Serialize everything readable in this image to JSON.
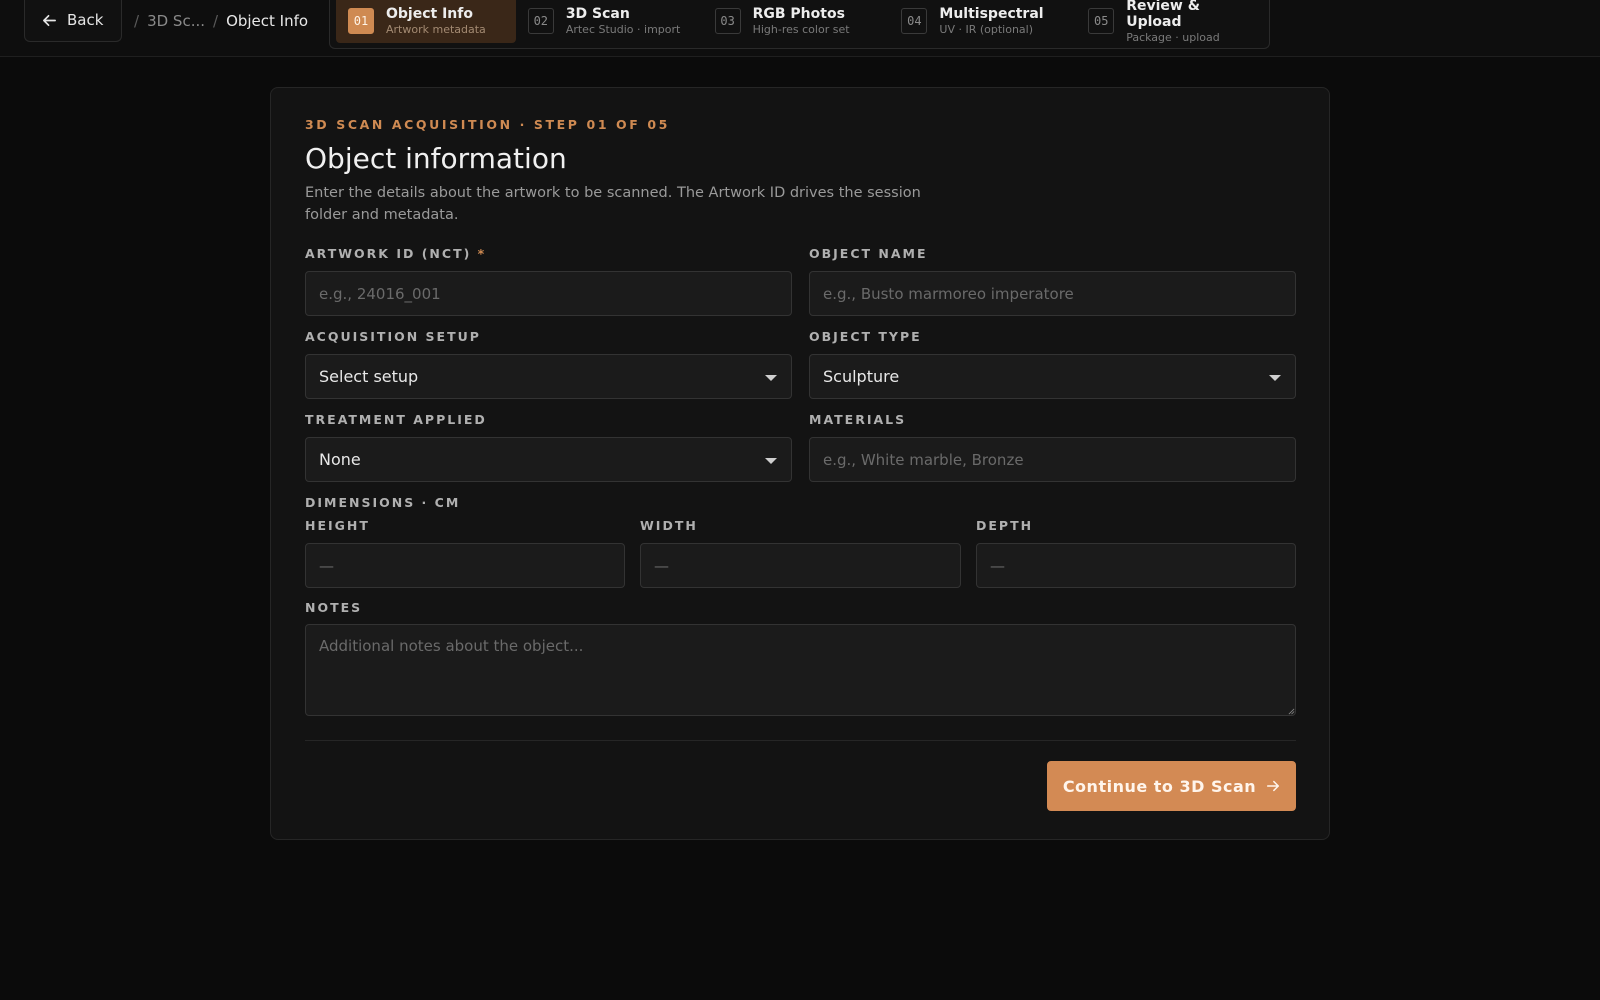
{
  "nav": {
    "back_label": "Back",
    "breadcrumb": [
      "3D Sc...",
      "Object Info"
    ]
  },
  "stepper": {
    "steps": [
      {
        "num": "01",
        "title": "Object Info",
        "sub": "Artwork metadata",
        "active": true
      },
      {
        "num": "02",
        "title": "3D Scan",
        "sub": "Artec Studio · import",
        "active": false
      },
      {
        "num": "03",
        "title": "RGB Photos",
        "sub": "High-res color set",
        "active": false
      },
      {
        "num": "04",
        "title": "Multispectral",
        "sub": "UV · IR (optional)",
        "active": false
      },
      {
        "num": "05",
        "title": "Review & Upload",
        "sub": "Package · upload",
        "active": false
      }
    ]
  },
  "form": {
    "eyebrow": "3D SCAN ACQUISITION · STEP 01 OF 05",
    "title": "Object information",
    "description": "Enter the details about the artwork to be scanned. The Artwork ID drives the session folder and metadata.",
    "artwork_id": {
      "label": "ARTWORK ID (NCT)",
      "required_mark": "*",
      "value": "",
      "placeholder": "e.g., 24016_001"
    },
    "object_name": {
      "label": "OBJECT NAME",
      "value": "",
      "placeholder": "e.g., Busto marmoreo imperatore"
    },
    "acquisition_setup": {
      "label": "ACQUISITION SETUP",
      "value": "Select setup"
    },
    "object_type": {
      "label": "OBJECT TYPE",
      "value": "Sculpture"
    },
    "treatment": {
      "label": "TREATMENT APPLIED",
      "value": "None"
    },
    "materials": {
      "label": "MATERIALS",
      "value": "",
      "placeholder": "e.g., White marble, Bronze"
    },
    "dimensions": {
      "label": "DIMENSIONS · CM",
      "height": {
        "label": "HEIGHT",
        "placeholder": "—"
      },
      "width": {
        "label": "WIDTH",
        "placeholder": "—"
      },
      "depth": {
        "label": "DEPTH",
        "placeholder": "—"
      }
    },
    "notes": {
      "label": "NOTES",
      "placeholder": "Additional notes about the object..."
    },
    "continue_label": "Continue to 3D Scan"
  },
  "colors": {
    "accent": "#d38a54",
    "background": "#0b0b0b",
    "card": "#131313"
  }
}
